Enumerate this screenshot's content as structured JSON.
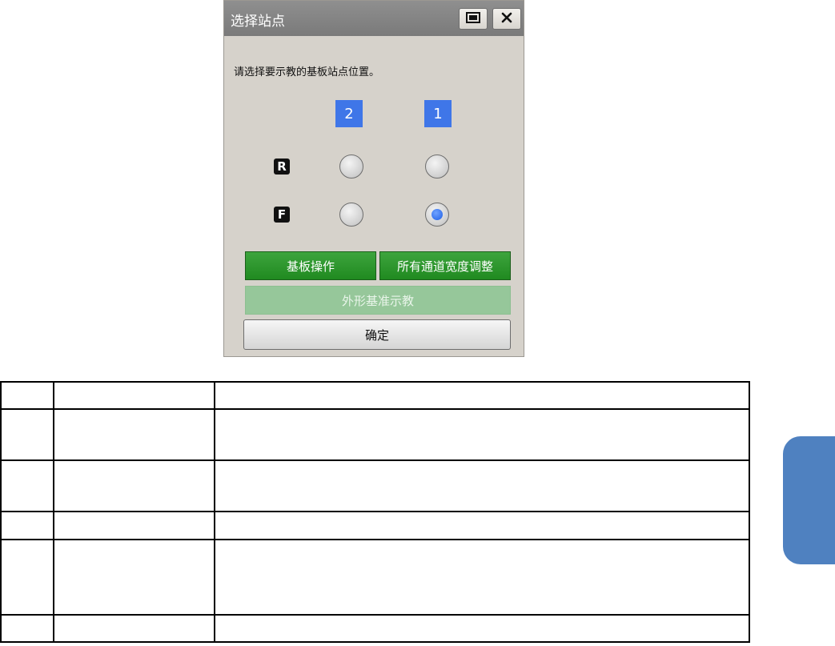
{
  "dialog": {
    "title": "选择站点",
    "instruction": "请选择要示教的基板站点位置。",
    "columns": [
      "2",
      "1"
    ],
    "rows": [
      {
        "label": "R",
        "selected_column": null
      },
      {
        "label": "F",
        "selected_column": "1"
      }
    ],
    "buttons": {
      "board_operation": "基板操作",
      "all_channel_width": "所有通道宽度调整",
      "outline_reference_teach": "外形基准示教",
      "ok": "确定"
    },
    "title_buttons": {
      "maximize": "maximize-icon",
      "close": "close-icon"
    },
    "colors": {
      "selection_blue": "#3f76e8",
      "action_green": "#2a982a",
      "disabled_green": "#96c79a"
    }
  },
  "table": {
    "rows": [
      [
        "",
        "",
        ""
      ],
      [
        "",
        "",
        ""
      ],
      [
        "",
        "",
        ""
      ],
      [
        "",
        "",
        ""
      ],
      [
        "",
        "",
        ""
      ],
      [
        "",
        "",
        ""
      ]
    ]
  },
  "side_tab": {
    "color": "#4f81c0"
  }
}
